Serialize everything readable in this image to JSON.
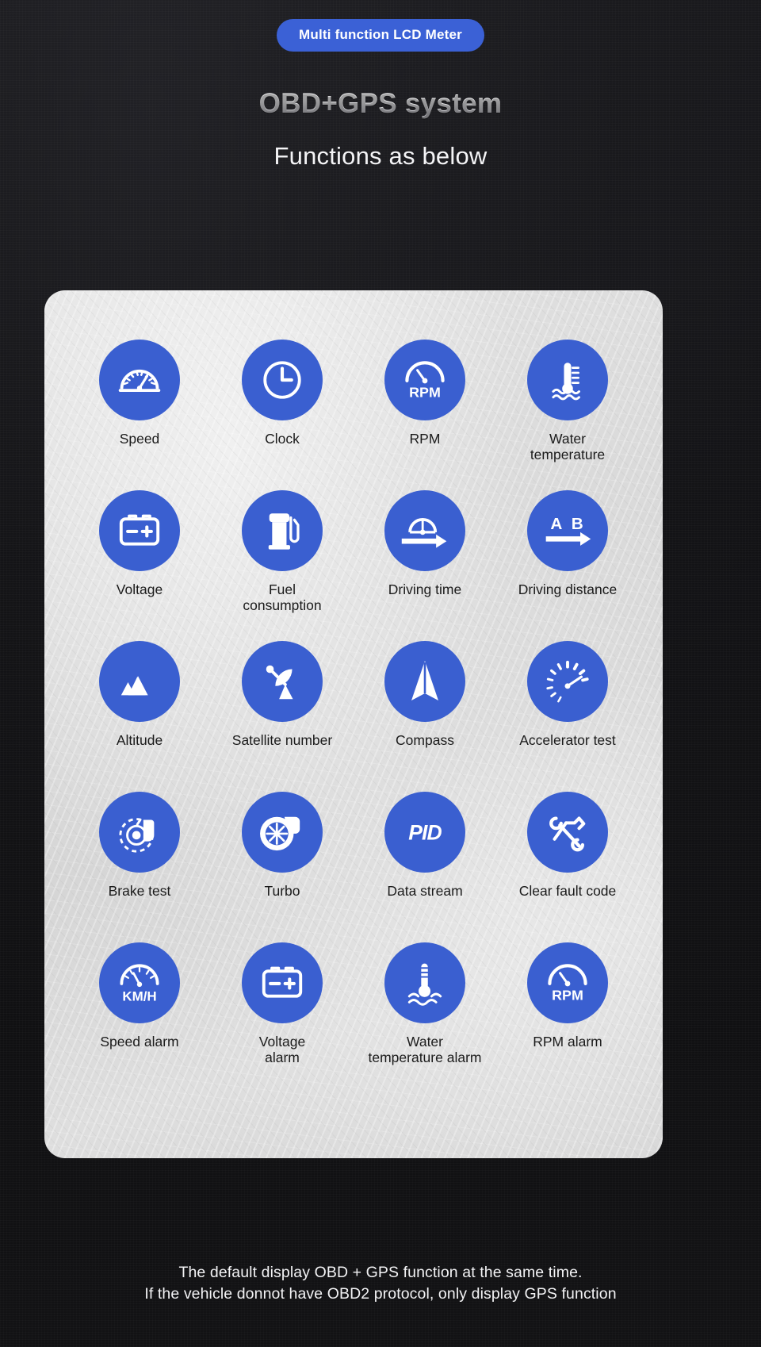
{
  "header": {
    "pill_label": "Multi function LCD Meter",
    "title": "OBD+GPS system",
    "subtitle": "Functions as below"
  },
  "theme": {
    "accent_blue": "#3a5fd0",
    "pill_blue": "#3b61d6",
    "card_gray": "#dcdcdc",
    "backdrop_dark": "#0d0d0f",
    "icon_white": "#ffffff",
    "label_text": "#1b1b1b"
  },
  "features": [
    {
      "label": "Speed",
      "icon": "speedometer-icon"
    },
    {
      "label": "Clock",
      "icon": "clock-icon"
    },
    {
      "label": "RPM",
      "icon": "rpm-gauge-icon"
    },
    {
      "label": "Water\ntemperature",
      "icon": "water-temperature-icon"
    },
    {
      "label": "Voltage",
      "icon": "battery-icon"
    },
    {
      "label": "Fuel\nconsumption",
      "icon": "fuel-pump-icon"
    },
    {
      "label": "Driving time",
      "icon": "gauge-arrow-icon"
    },
    {
      "label": "Driving distance",
      "icon": "a-to-b-arrow-icon"
    },
    {
      "label": "Altitude",
      "icon": "mountains-icon"
    },
    {
      "label": "Satellite number",
      "icon": "satellite-dish-icon"
    },
    {
      "label": "Compass",
      "icon": "compass-needle-icon"
    },
    {
      "label": "Accelerator test",
      "icon": "accelerator-gauge-icon"
    },
    {
      "label": "Brake test",
      "icon": "brake-rotor-icon"
    },
    {
      "label": "Turbo",
      "icon": "turbocharger-icon"
    },
    {
      "label": "Data stream",
      "icon": "pid-text-icon"
    },
    {
      "label": "Clear fault code",
      "icon": "crossed-wrenches-icon"
    },
    {
      "label": "Speed alarm",
      "icon": "kmh-gauge-icon"
    },
    {
      "label": "Voltage\nalarm",
      "icon": "battery-icon"
    },
    {
      "label": "Water\ntemperature alarm",
      "icon": "water-temperature-icon"
    },
    {
      "label": "RPM alarm",
      "icon": "rpm-gauge-icon"
    }
  ],
  "footer": {
    "line1": "The default display OBD + GPS function at the same time.",
    "line2": "If the vehicle donnot have OBD2 protocol, only display GPS function"
  }
}
